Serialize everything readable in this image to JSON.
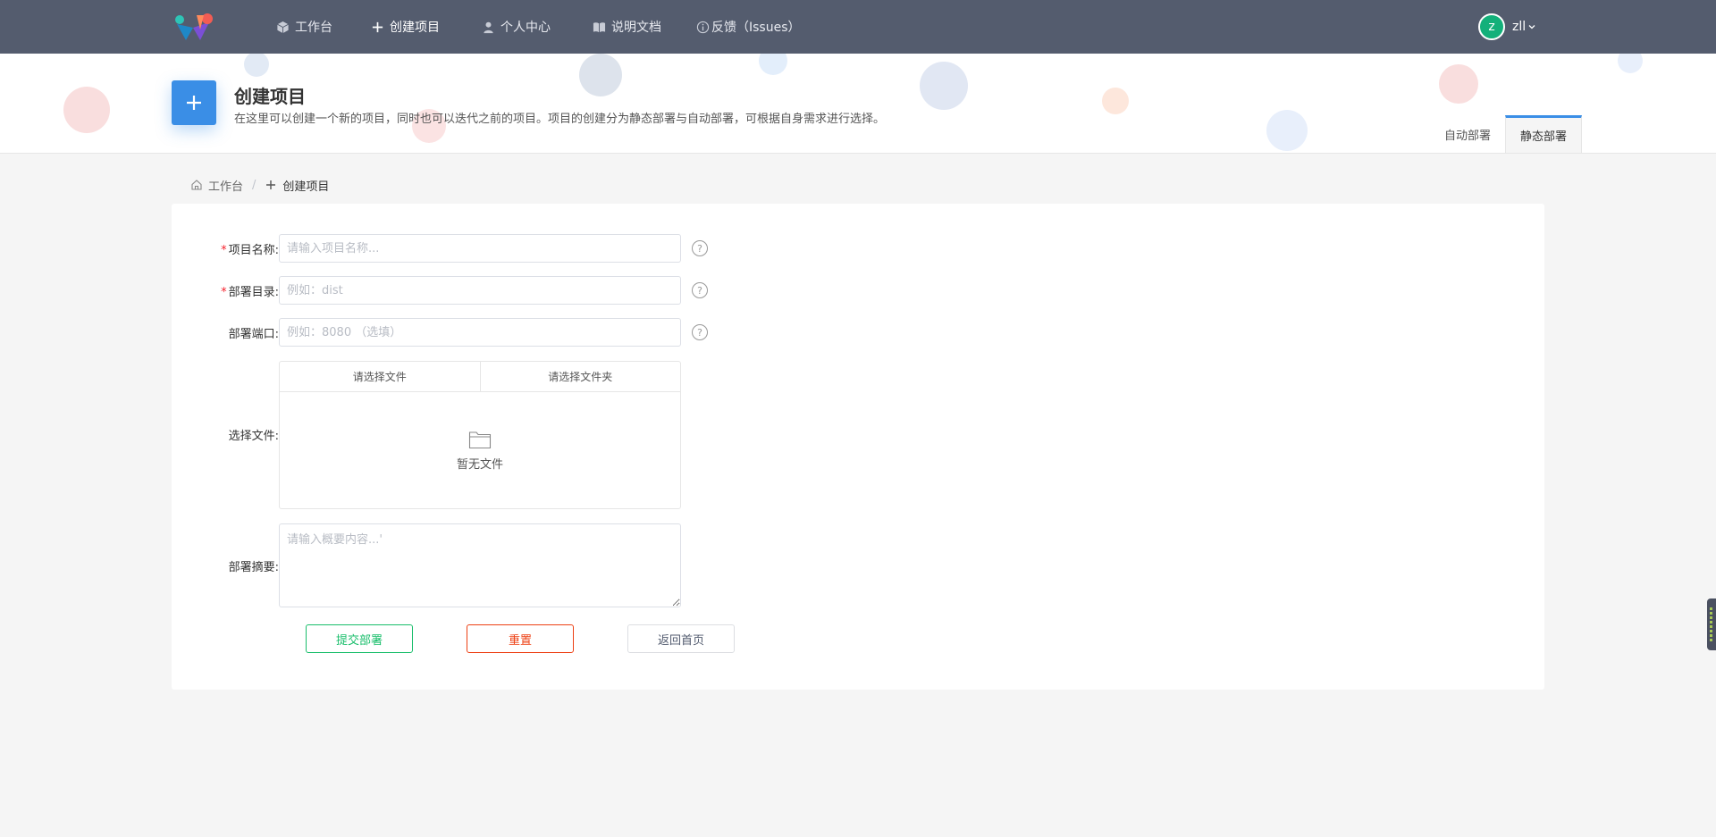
{
  "nav": {
    "items": [
      {
        "label": "工作台",
        "icon": "cube-icon"
      },
      {
        "label": "创建项目",
        "icon": "plus-icon"
      },
      {
        "label": "个人中心",
        "icon": "user-icon"
      },
      {
        "label": "说明文档",
        "icon": "book-icon"
      },
      {
        "label": "反馈（Issues）",
        "icon": "info-icon"
      }
    ],
    "user": {
      "avatar_letter": "z",
      "name": "zll"
    }
  },
  "header": {
    "title": "创建项目",
    "description": "在这里可以创建一个新的项目，同时也可以迭代之前的项目。项目的创建分为静态部署与自动部署，可根据自身需求进行选择。",
    "tabs": [
      "自动部署",
      "静态部署"
    ],
    "active_tab": "静态部署"
  },
  "breadcrumb": {
    "home": "工作台",
    "separator": "/",
    "current": "创建项目"
  },
  "form": {
    "project_name": {
      "label": "项目名称:",
      "required": true,
      "placeholder": "请输入项目名称...",
      "value": ""
    },
    "deploy_dir": {
      "label": "部署目录:",
      "required": true,
      "placeholder": "例如：dist",
      "value": ""
    },
    "deploy_port": {
      "label": "部署端口:",
      "required": false,
      "placeholder": "例如：8080 （选填）",
      "value": ""
    },
    "file_select": {
      "label": "选择文件:",
      "tab_file": "请选择文件",
      "tab_folder": "请选择文件夹",
      "empty_text": "暂无文件"
    },
    "summary": {
      "label": "部署摘要:",
      "placeholder": "请输入概要内容...'",
      "value": ""
    },
    "help_glyph": "?",
    "buttons": {
      "submit": "提交部署",
      "reset": "重置",
      "home": "返回首页"
    }
  },
  "colors": {
    "nav_bg": "#545c6e",
    "primary": "#3a8ee6",
    "success": "#19be6b",
    "danger": "#ed4014",
    "avatar": "#13b07a"
  }
}
